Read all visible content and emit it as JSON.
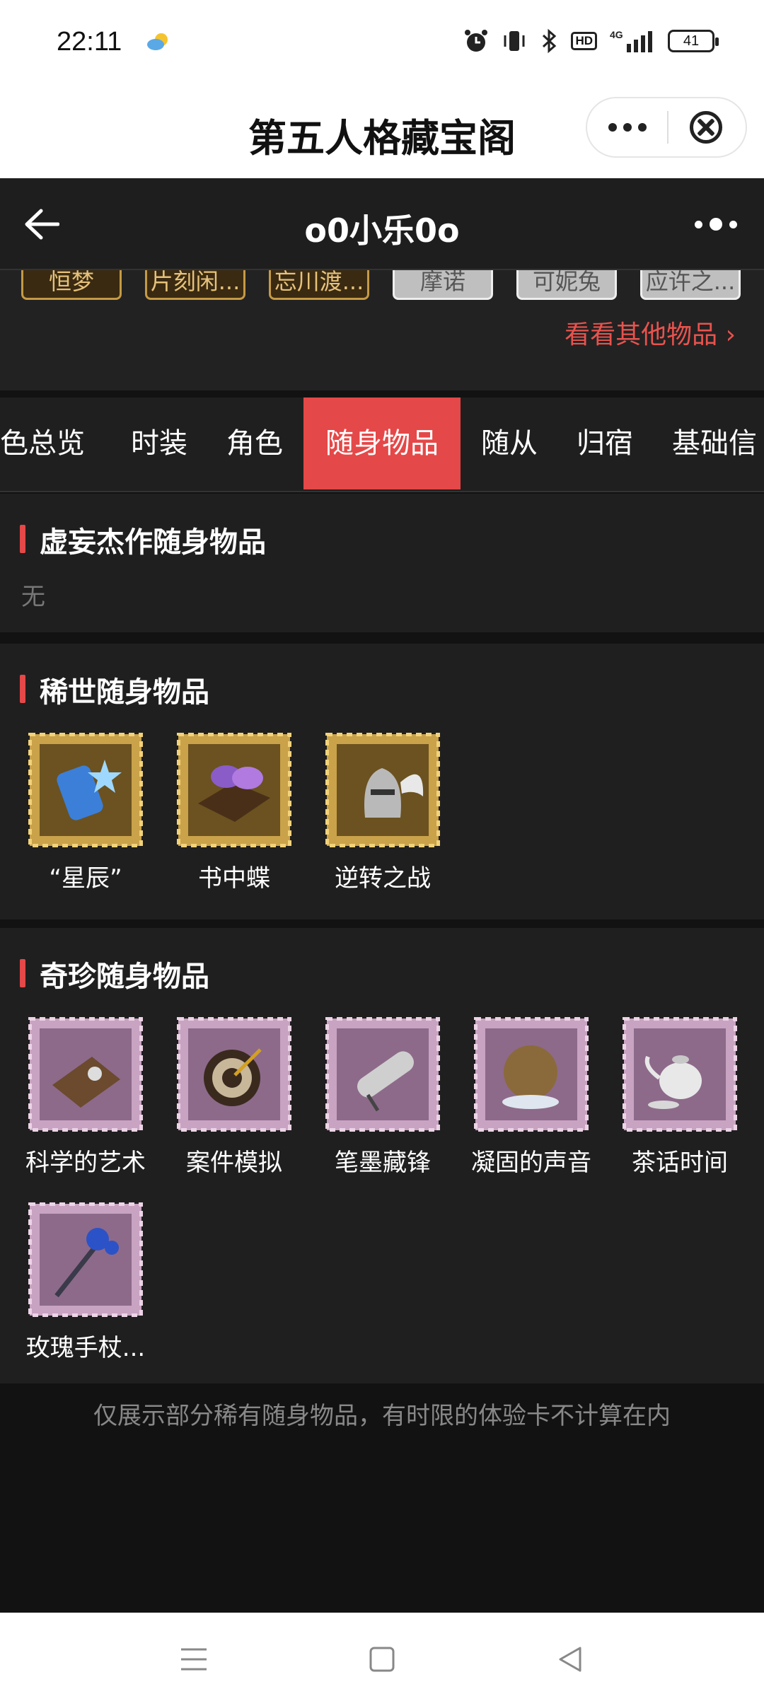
{
  "status_bar": {
    "time": "22:11",
    "hd": "HD",
    "network": "4G",
    "battery": "41"
  },
  "mini_program": {
    "title": "第五人格藏宝阁"
  },
  "header": {
    "title": "o0小乐0o"
  },
  "skins": [
    {
      "label": "恒梦",
      "tier": "gold"
    },
    {
      "label": "片刻闲...",
      "tier": "gold"
    },
    {
      "label": "忘川渡...",
      "tier": "gold"
    },
    {
      "label": "摩诺",
      "tier": "silver"
    },
    {
      "label": "可妮兔",
      "tier": "silver"
    },
    {
      "label": "应许之...",
      "tier": "silver"
    }
  ],
  "see_more": "看看其他物品",
  "tabs": [
    "色总览",
    "时装",
    "角色",
    "随身物品",
    "随从",
    "归宿",
    "基础信"
  ],
  "active_tab": "随身物品",
  "sections": {
    "masterpiece": {
      "title": "虚妄杰作随身物品",
      "empty": "无"
    },
    "rare": {
      "title": "稀世随身物品",
      "items": [
        {
          "label": "“星辰”",
          "icon": "star-crystal-icon"
        },
        {
          "label": "书中蝶",
          "icon": "butterfly-book-icon"
        },
        {
          "label": "逆转之战",
          "icon": "winged-helmet-icon"
        }
      ]
    },
    "precious": {
      "title": "奇珍随身物品",
      "items": [
        {
          "label": "科学的艺术",
          "icon": "science-book-icon"
        },
        {
          "label": "案件模拟",
          "icon": "target-icon"
        },
        {
          "label": "笔墨藏锋",
          "icon": "scroll-icon"
        },
        {
          "label": "凝固的声音",
          "icon": "orb-icon"
        },
        {
          "label": "茶话时间",
          "icon": "teapot-icon"
        },
        {
          "label": "玫瑰手杖...",
          "icon": "rose-cane-icon"
        }
      ]
    }
  },
  "footer_note": "仅展示部分稀有随身物品，有时限的体验卡不计算在内",
  "colors": {
    "accent": "#e54848",
    "gold_stamp": "#c9a24a",
    "pink_stamp": "#c9a3c2"
  }
}
